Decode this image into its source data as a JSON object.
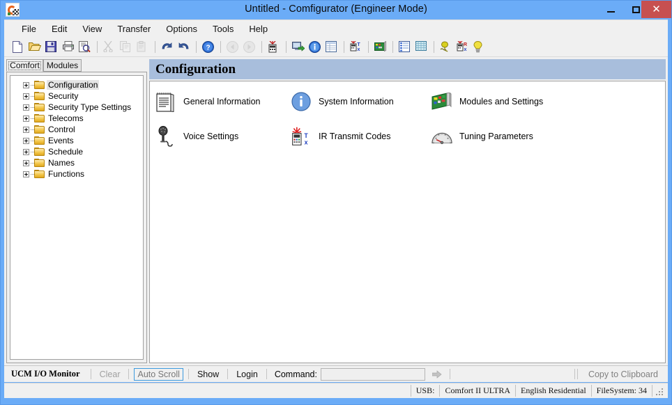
{
  "window": {
    "title": "Untitled - Comfigurator (Engineer Mode)",
    "app_icon": "comfigurator-icon",
    "minimize_label": "–",
    "maximize_label": "□",
    "close_label": "✕",
    "title_bar_color": "#6bacf7",
    "close_button_color": "#c75050"
  },
  "menu": {
    "items": [
      {
        "label": "File"
      },
      {
        "label": "Edit"
      },
      {
        "label": "View"
      },
      {
        "label": "Transfer"
      },
      {
        "label": "Options"
      },
      {
        "label": "Tools"
      },
      {
        "label": "Help"
      }
    ]
  },
  "toolbar": {
    "buttons": [
      {
        "icon": "new-document-icon",
        "enabled": true
      },
      {
        "icon": "open-folder-icon",
        "enabled": true
      },
      {
        "icon": "save-disk-icon",
        "enabled": true
      },
      {
        "icon": "print-icon",
        "enabled": true
      },
      {
        "icon": "print-preview-icon",
        "enabled": true
      },
      {
        "icon": "separator"
      },
      {
        "icon": "cut-scissors-icon",
        "enabled": false
      },
      {
        "icon": "copy-icon",
        "enabled": false
      },
      {
        "icon": "paste-icon",
        "enabled": false
      },
      {
        "icon": "separator"
      },
      {
        "icon": "undo-arrow-icon",
        "enabled": true
      },
      {
        "icon": "redo-arrow-icon",
        "enabled": true
      },
      {
        "icon": "separator"
      },
      {
        "icon": "help-question-icon",
        "enabled": true
      },
      {
        "icon": "separator"
      },
      {
        "icon": "back-navigate-icon",
        "enabled": false
      },
      {
        "icon": "forward-navigate-icon",
        "enabled": false
      },
      {
        "icon": "separator"
      },
      {
        "icon": "download-from-panel-icon",
        "enabled": true
      },
      {
        "icon": "separator"
      },
      {
        "icon": "connect-computer-icon",
        "enabled": true
      },
      {
        "icon": "system-info-icon",
        "enabled": true
      },
      {
        "icon": "table-view-icon",
        "enabled": true
      },
      {
        "icon": "separator"
      },
      {
        "icon": "transmit-tx-icon",
        "enabled": true
      },
      {
        "icon": "separator"
      },
      {
        "icon": "modules-board-icon",
        "enabled": true
      },
      {
        "icon": "separator"
      },
      {
        "icon": "properties-list-icon",
        "enabled": true
      },
      {
        "icon": "grid-table-icon",
        "enabled": true
      },
      {
        "icon": "separator"
      },
      {
        "icon": "voice-settings-icon",
        "enabled": true
      },
      {
        "icon": "receive-rx-icon",
        "enabled": true
      },
      {
        "icon": "lightbulb-icon",
        "enabled": true
      }
    ]
  },
  "sidebar": {
    "tabs": [
      {
        "label": "Comfort",
        "active": true
      },
      {
        "label": "Modules",
        "active": false
      }
    ],
    "tree": [
      {
        "label": "Configuration",
        "selected": true
      },
      {
        "label": "Security",
        "selected": false
      },
      {
        "label": "Security Type Settings",
        "selected": false
      },
      {
        "label": "Telecoms",
        "selected": false
      },
      {
        "label": "Control",
        "selected": false
      },
      {
        "label": "Events",
        "selected": false
      },
      {
        "label": "Schedule",
        "selected": false
      },
      {
        "label": "Names",
        "selected": false
      },
      {
        "label": "Functions",
        "selected": false
      }
    ]
  },
  "content": {
    "heading": "Configuration",
    "heading_bg": "#a8bedc",
    "tiles": [
      {
        "label": "General Information",
        "icon": "notepad-icon",
        "col": 0,
        "row": 0
      },
      {
        "label": "System Information",
        "icon": "info-circle-icon",
        "col": 1,
        "row": 0
      },
      {
        "label": "Modules and Settings",
        "icon": "circuit-board-icon",
        "col": 2,
        "row": 0
      },
      {
        "label": "Voice Settings",
        "icon": "microphone-icon",
        "col": 0,
        "row": 1
      },
      {
        "label": "IR Transmit Codes",
        "icon": "ir-remote-icon",
        "col": 1,
        "row": 1
      },
      {
        "label": "Tuning Parameters",
        "icon": "gauge-icon",
        "col": 2,
        "row": 1
      }
    ]
  },
  "ucm_bar": {
    "title": "UCM I/O Monitor",
    "clear_label": "Clear",
    "autoscroll_label": "Auto Scroll",
    "show_label": "Show",
    "login_label": "Login",
    "command_label": "Command:",
    "command_value": "",
    "command_placeholder": "",
    "go_icon": "arrow-right-icon",
    "copy_clipboard_label": "Copy to Clipboard"
  },
  "statusbar": {
    "cells": [
      {
        "label": "USB:"
      },
      {
        "label": "Comfort II ULTRA"
      },
      {
        "label": "English Residential"
      },
      {
        "label": "FileSystem: 34"
      }
    ],
    "grip_icon": "resize-grip-icon"
  }
}
